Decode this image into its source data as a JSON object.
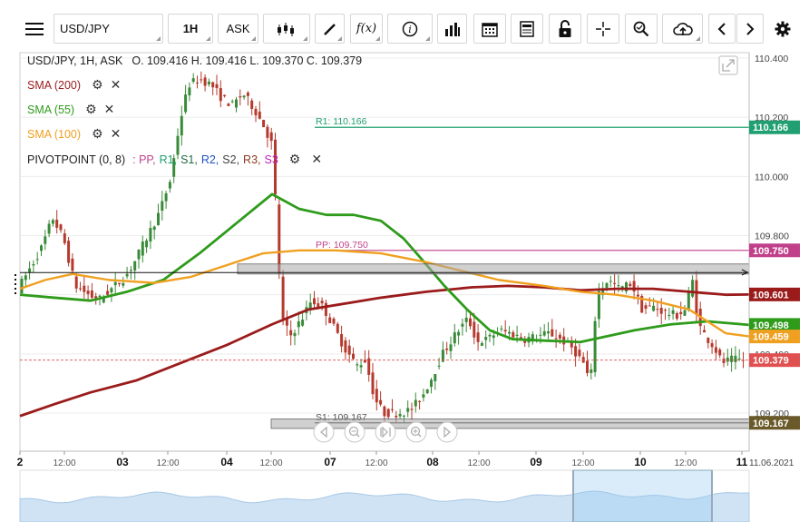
{
  "toolbar": {
    "menu_icon": "hamburger-icon",
    "symbol": "USD/JPY",
    "timeframe": "1H",
    "price_side": "ASK",
    "tools": [
      "candle-type-icon",
      "draw-pencil-icon",
      "function-icon",
      "info-icon",
      "indicators-bars-icon",
      "calendar-icon",
      "report-icon",
      "lock-icon",
      "crosshair-icon",
      "zoom-icon",
      "cloud-upload-icon",
      "prev-arrow-icon",
      "next-arrow-icon",
      "settings-gear-icon"
    ],
    "function_label": "f(x)"
  },
  "legend": {
    "title": "USD/JPY, 1H, ASK",
    "ohlc": "O. 109.416 H. 109.416 L. 109.370 C. 109.379",
    "indicators": [
      {
        "label": "SMA (200)",
        "color": "#9b1b1b"
      },
      {
        "label": "SMA (55)",
        "color": "#2e9b1b"
      },
      {
        "label": "SMA (100)",
        "color": "#f0a020"
      }
    ],
    "pivot": {
      "label": "PIVOTPOINT (0, 8)",
      "prefix": ": PP,",
      "items": [
        {
          "label": "R1,",
          "color": "#20a070"
        },
        {
          "label": "S1,",
          "color": "#206a40"
        },
        {
          "label": "R2,",
          "color": "#2050c0"
        },
        {
          "label": "S2,",
          "color": "#404040"
        },
        {
          "label": "R3,",
          "color": "#8a3a20"
        },
        {
          "label": "S3",
          "color": "#c020c0"
        }
      ]
    }
  },
  "chart_data": {
    "type": "candlestick",
    "symbol": "USD/JPY",
    "timeframe": "1H",
    "y_axis_ticks": [
      "110.400",
      "110.200",
      "110.000",
      "109.800",
      "109.400",
      "109.200"
    ],
    "y_range": [
      109.14,
      110.42
    ],
    "x_axis_ticks": [
      "2",
      "12:00",
      "03",
      "12:00",
      "04",
      "12:00",
      "07",
      "12:00",
      "08",
      "12:00",
      "09",
      "12:00",
      "10",
      "12:00",
      "11"
    ],
    "x_end_label": "11.06.2021",
    "price_tags": [
      {
        "value": "110.166",
        "color": "#20a070"
      },
      {
        "value": "109.750",
        "color": "#c0408a"
      },
      {
        "value": "109.601",
        "color": "#9b1b1b"
      },
      {
        "value": "109.498",
        "color": "#2e9b1b"
      },
      {
        "value": "109.459",
        "color": "#f0a020"
      },
      {
        "value": "109.379",
        "color": "#e05050"
      },
      {
        "value": "109.167",
        "color": "#6a5a2a"
      }
    ],
    "pivot_levels": [
      {
        "label": "R1: 110.166",
        "value": 110.166,
        "color": "#20a070"
      },
      {
        "label": "PP: 109.750",
        "value": 109.75,
        "color": "#c0408a"
      },
      {
        "label": "S1: 109.167",
        "value": 109.167,
        "color": "#555555"
      }
    ],
    "last_price": 109.379,
    "series": [
      {
        "name": "SMA (200)",
        "color": "#9b1b1b"
      },
      {
        "name": "SMA (55)",
        "color": "#2e9b1b"
      },
      {
        "name": "SMA (100)",
        "color": "#f0a020"
      }
    ]
  }
}
